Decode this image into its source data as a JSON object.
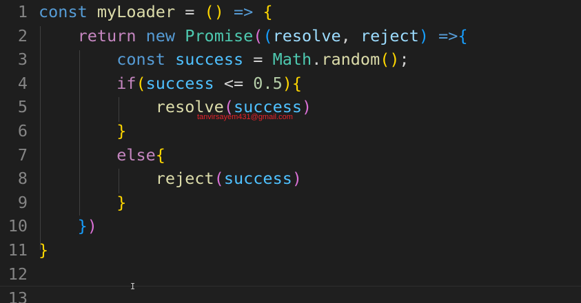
{
  "editor": {
    "line_numbers": [
      "1",
      "2",
      "3",
      "4",
      "5",
      "6",
      "7",
      "8",
      "9",
      "10",
      "11",
      "12",
      "13"
    ],
    "lines": [
      [
        {
          "t": "const",
          "c": "kw"
        },
        {
          "t": " ",
          "c": "op"
        },
        {
          "t": "myLoader",
          "c": "fn"
        },
        {
          "t": " = ",
          "c": "op"
        },
        {
          "t": "()",
          "c": "b1"
        },
        {
          "t": " ",
          "c": "op"
        },
        {
          "t": "=>",
          "c": "kw"
        },
        {
          "t": " ",
          "c": "op"
        },
        {
          "t": "{",
          "c": "b1"
        }
      ],
      [
        {
          "t": "    ",
          "c": "op"
        },
        {
          "t": "return",
          "c": "ctl"
        },
        {
          "t": " ",
          "c": "op"
        },
        {
          "t": "new",
          "c": "kw"
        },
        {
          "t": " ",
          "c": "op"
        },
        {
          "t": "Promise",
          "c": "cls"
        },
        {
          "t": "(",
          "c": "b2"
        },
        {
          "t": "(",
          "c": "b3"
        },
        {
          "t": "resolve",
          "c": "var"
        },
        {
          "t": ", ",
          "c": "op"
        },
        {
          "t": "reject",
          "c": "var"
        },
        {
          "t": ")",
          "c": "b3"
        },
        {
          "t": " ",
          "c": "op"
        },
        {
          "t": "=>",
          "c": "kw"
        },
        {
          "t": "{",
          "c": "b3"
        }
      ],
      [
        {
          "t": "        ",
          "c": "op"
        },
        {
          "t": "const",
          "c": "kw"
        },
        {
          "t": " ",
          "c": "op"
        },
        {
          "t": "success",
          "c": "const"
        },
        {
          "t": " = ",
          "c": "op"
        },
        {
          "t": "Math",
          "c": "cls"
        },
        {
          "t": ".",
          "c": "op"
        },
        {
          "t": "random",
          "c": "fn"
        },
        {
          "t": "()",
          "c": "b1"
        },
        {
          "t": ";",
          "c": "op"
        }
      ],
      [
        {
          "t": "        ",
          "c": "op"
        },
        {
          "t": "if",
          "c": "ctl"
        },
        {
          "t": "(",
          "c": "b1"
        },
        {
          "t": "success",
          "c": "const"
        },
        {
          "t": " <= ",
          "c": "op"
        },
        {
          "t": "0.5",
          "c": "num"
        },
        {
          "t": ")",
          "c": "b1"
        },
        {
          "t": "{",
          "c": "b1"
        }
      ],
      [
        {
          "t": "            ",
          "c": "op"
        },
        {
          "t": "resolve",
          "c": "fn"
        },
        {
          "t": "(",
          "c": "b2"
        },
        {
          "t": "success",
          "c": "const"
        },
        {
          "t": ")",
          "c": "b2"
        }
      ],
      [
        {
          "t": "        ",
          "c": "op"
        },
        {
          "t": "}",
          "c": "b1"
        }
      ],
      [
        {
          "t": "        ",
          "c": "op"
        },
        {
          "t": "else",
          "c": "ctl"
        },
        {
          "t": "{",
          "c": "b1"
        }
      ],
      [
        {
          "t": "            ",
          "c": "op"
        },
        {
          "t": "reject",
          "c": "fn"
        },
        {
          "t": "(",
          "c": "b2"
        },
        {
          "t": "success",
          "c": "const"
        },
        {
          "t": ")",
          "c": "b2"
        }
      ],
      [
        {
          "t": "        ",
          "c": "op"
        },
        {
          "t": "}",
          "c": "b1"
        }
      ],
      [
        {
          "t": "    ",
          "c": "op"
        },
        {
          "t": "}",
          "c": "b3"
        },
        {
          "t": ")",
          "c": "b2"
        }
      ],
      [
        {
          "t": "}",
          "c": "b1"
        }
      ],
      [],
      []
    ],
    "current_line": 13
  },
  "watermark": {
    "text": "tanvirsayem431@gmail.com"
  }
}
